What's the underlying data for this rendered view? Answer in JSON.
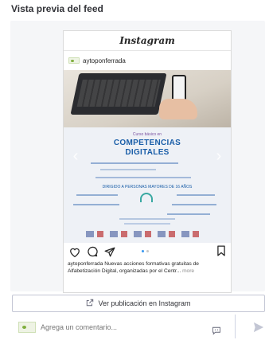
{
  "page": {
    "title": "Vista previa del feed"
  },
  "post": {
    "platform_logo": "Instagram",
    "account": "aytoponferrada",
    "poster": {
      "subtitle": "Curso básico en",
      "title_line1": "COMPETENCIAS",
      "title_line2": "DIGITALES",
      "audience": "DIRIGIDO A PERSONAS MAYORES DE 16 AÑOS"
    },
    "carousel": {
      "slides": 2,
      "active": 1
    },
    "caption": {
      "user": "aytoponferrada",
      "text": "Nuevas acciones formativas gratuitas de Alfabetización Digital, organizadas por el Centr...",
      "more": "more"
    }
  },
  "actions": {
    "view_label": "Ver publicación en Instagram"
  },
  "comment": {
    "placeholder": "Agrega un comentario..."
  },
  "icons": [
    "heart-icon",
    "comment-icon",
    "send-icon",
    "bookmark-icon",
    "external-link-icon",
    "emoji-icon",
    "paper-plane-icon",
    "chevron-left-icon",
    "chevron-right-icon"
  ]
}
